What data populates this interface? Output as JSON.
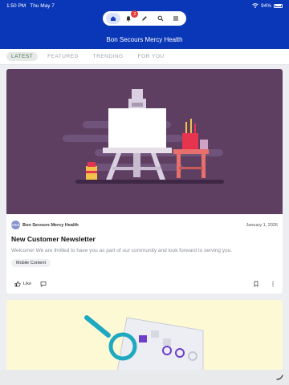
{
  "status": {
    "time": "1:50 PM",
    "date": "Thu May 7",
    "battery": "94%"
  },
  "nav": {
    "items": [
      "home-icon",
      "bell-icon",
      "edit-icon",
      "search-icon",
      "menu-icon"
    ],
    "notification_count": "2"
  },
  "header": {
    "brand": "Bon Secours Mercy Health"
  },
  "tabs": [
    "LATEST",
    "FEATURED",
    "TRENDING",
    "FOR YOU"
  ],
  "post": {
    "avatar_initials": "BSMH",
    "source": "Bon Secours Mercy Health",
    "date": "January 1, 2026",
    "title": "New Customer Newsletter",
    "description": "Welcome! We are thrilled to have you as part of our community and look forward to serving you.",
    "tag": "Mobile Content",
    "like_label": "Like"
  },
  "colors": {
    "brand_blue": "#0a36b8",
    "hero_bg": "#5e3f62",
    "second_card_bg": "#fdf9d5"
  }
}
